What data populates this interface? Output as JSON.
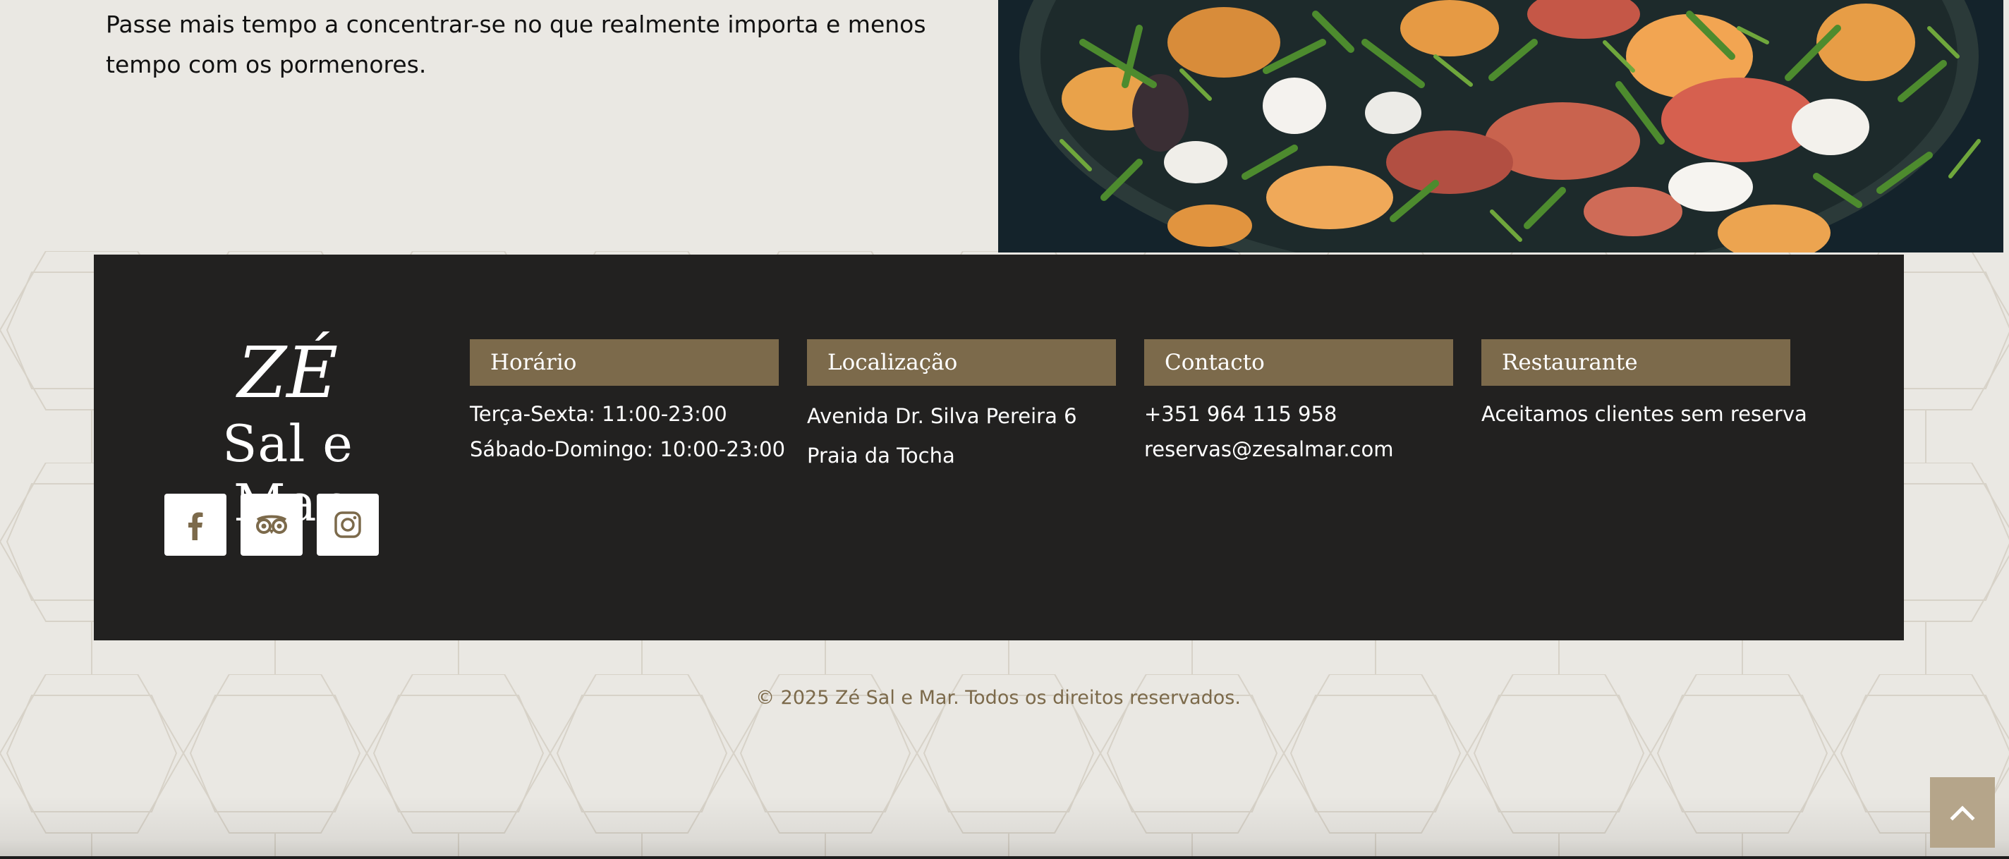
{
  "intro": {
    "line1": "Passe mais tempo a concentrar-se no que realmente importa e menos",
    "line2": "tempo com os pormenores."
  },
  "brand": {
    "mark": "ZÉ",
    "name": "Sal e Mar"
  },
  "socials": [
    {
      "icon": "facebook-icon"
    },
    {
      "icon": "tripadvisor-icon"
    },
    {
      "icon": "instagram-icon"
    }
  ],
  "columns": {
    "horario": {
      "title": "Horário",
      "lines": [
        "Terça-Sexta: 11:00-23:00",
        "Sábado-Domingo: 10:00-23:00"
      ]
    },
    "localizacao": {
      "title": "Localização",
      "lines": [
        "Avenida Dr. Silva Pereira 6",
        "Praia da Tocha"
      ]
    },
    "contacto": {
      "title": "Contacto",
      "lines": [
        "+351 964 115 958",
        "reservas@zesalmar.com"
      ]
    },
    "restaurante": {
      "title": "Restaurante",
      "lines": [
        "Aceitamos clientes sem reserva"
      ]
    }
  },
  "copyright": "© 2025 Zé Sal e Mar. Todos os direitos reservados.",
  "colors": {
    "background": "#eae8e3",
    "footer": "#222120",
    "accent": "#7c6a4b",
    "scroll_top": "#b5a58a"
  },
  "icons": {
    "scroll_top": "chevron-up-icon"
  }
}
